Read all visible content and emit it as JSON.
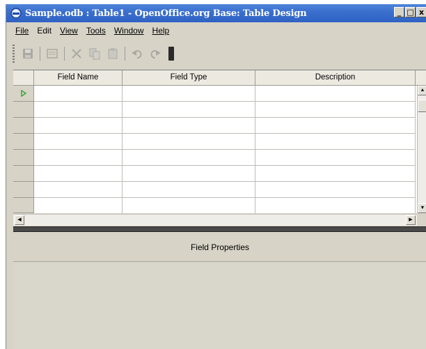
{
  "window": {
    "title": "Sample.odb : Table1 - OpenOffice.org Base: Table Design",
    "controls": [
      "_",
      "□",
      "x"
    ]
  },
  "menu": {
    "items": [
      {
        "label": "File"
      },
      {
        "label": "Edit"
      },
      {
        "label": "View"
      },
      {
        "label": "Tools"
      },
      {
        "label": "Window"
      },
      {
        "label": "Help"
      }
    ]
  },
  "toolbar": {
    "icons": [
      "save-icon",
      "edit-icon",
      "cut-icon",
      "copy-icon",
      "paste-icon",
      "undo-icon",
      "redo-icon"
    ]
  },
  "grid": {
    "columns": [
      "Field Name",
      "Field Type",
      "Description"
    ],
    "row_count": 8,
    "active_row_marker": "play-icon"
  },
  "properties": {
    "title": "Field Properties"
  },
  "colors": {
    "titlebar": "#3b70cf",
    "window_bg": "#d7d3c7",
    "active_marker": "#3aa83a"
  }
}
